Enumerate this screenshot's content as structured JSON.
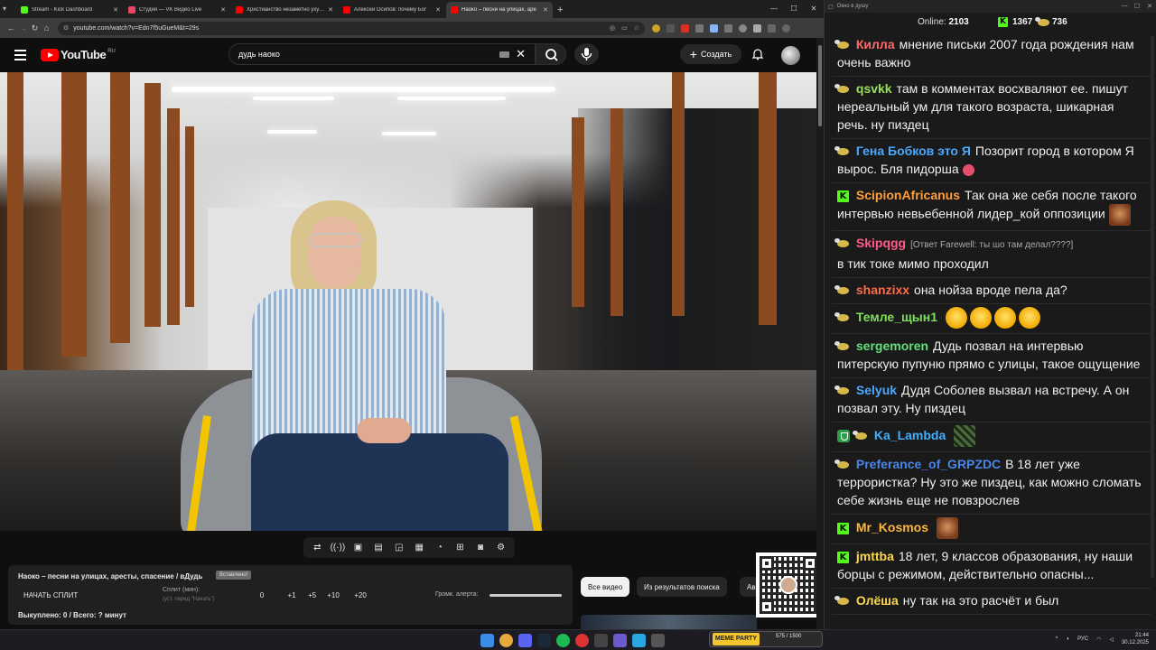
{
  "browser": {
    "tabs": [
      {
        "title": "Stream - Kick Dashboard",
        "color": "#53fc18",
        "active": false
      },
      {
        "title": "Студия — VK Видео Live",
        "color": "#e8485f",
        "active": false
      },
      {
        "title": "Христианство незаметно ухудш",
        "color": "#ff0000",
        "active": false
      },
      {
        "title": "Алексей Осипов: почему Бог",
        "color": "#ff0000",
        "active": false
      },
      {
        "title": "Наоко – песни на улицах, аре",
        "color": "#ff0000",
        "active": true
      }
    ],
    "url": "youtube.com/watch?v=Edn7f5uGueM&t=29s"
  },
  "youtube": {
    "logo_text": "YouTube",
    "country": "RU",
    "search_query": "дудь наоко",
    "create_label": "Создать"
  },
  "panel": {
    "title": "Наоко – песни на улицах, аресты, спасение / вДудь",
    "badge": "Вставлено!",
    "start_label": "НАЧАТЬ СПЛИТ",
    "split_label": "Сплит (мин):",
    "split_hint": "(уст. перед \"Начать\")",
    "increments": [
      "0",
      "+1",
      "+5",
      "+10",
      "+20"
    ],
    "volume_label": "Громк. алерта:",
    "alert_volume": 1.0,
    "bought": "Выкуплено: 0 / Всего: ? минут"
  },
  "chips": {
    "all": "Все видео",
    "search_results": "Из результатов поиска",
    "more": "Ав"
  },
  "chat": {
    "online_label": "Online:",
    "online_count": "2103",
    "kick_count": "1367",
    "other_count": "736",
    "messages": [
      {
        "badge": "bee",
        "nick": "Килла",
        "color": "#ff6b6b",
        "text": "мнение письки 2007 года рождения нам очень важно"
      },
      {
        "badge": "bee",
        "nick": "qsvkk",
        "color": "#9be05a",
        "text": "там в комментах восхваляют ее. пишут нереальный ум для такого возраста, шикарная речь. ну пиздец"
      },
      {
        "badge": "bee",
        "nick": "Гена Бобков это Я",
        "color": "#4aa8ff",
        "text": "Позорит город в котором Я вырос. Бля пидорша",
        "emote": "red"
      },
      {
        "badge": "kick",
        "nick": "ScipionAfricanus",
        "color": "#ff9f3b",
        "text": "Так она же себя после такого интервью невьебенной лидер_кой оппозиции",
        "emote": "face"
      },
      {
        "badge": "bee",
        "nick": "Skipqgg",
        "color": "#ff5c8a",
        "reply": "[Ответ Farewell: ты шо там делал????]",
        "text": "в тик токе мимо проходил"
      },
      {
        "badge": "bee",
        "nick": "shanzixx",
        "color": "#ff6b4a",
        "text": "она нойза вроде пела да?"
      },
      {
        "badge": "bee",
        "nick": "Темле_щын1",
        "color": "#7ee05a",
        "text": "",
        "emote": "smiles"
      },
      {
        "badge": "bee",
        "nick": "sergemoren",
        "color": "#63e07a",
        "text": "Дудь позвал на интервью питерскую пупуню прямо с улицы, такое ощущение"
      },
      {
        "badge": "bee",
        "nick": "Selyuk",
        "color": "#4aa8ff",
        "text": "Дудя Соболев вызвал на встречу. А он позвал эту. Ну пиздец"
      },
      {
        "badge": "shield",
        "nick": "Ka_Lambda",
        "color": "#3fb0ff",
        "text": "",
        "emote": "pixel"
      },
      {
        "badge": "bee",
        "nick": "Preferance_of_GRPZDC",
        "color": "#4a86e8",
        "text": "В 18 лет уже террористка? Ну это же пиздец, как можно сломать себе жизнь еще не повзрослев"
      },
      {
        "badge": "kick",
        "nick": "Mr_Kosmos",
        "color": "#ffb63b",
        "text": "",
        "emote": "face"
      },
      {
        "badge": "kick",
        "nick": "jmttba",
        "color": "#ffd84a",
        "text": "18 лет, 9 классов образования, ну наши борцы с режимом, действительно опасны..."
      },
      {
        "badge": "bee",
        "nick": "Олёша",
        "color": "#ffd84a",
        "text": "ну так на это расчёт и был"
      }
    ]
  },
  "taskbar": {
    "media_label": "MEME PARTY",
    "media_count": "575 / 1500",
    "lang": "РУС",
    "time": "21:44",
    "date": "30.12.2025"
  }
}
